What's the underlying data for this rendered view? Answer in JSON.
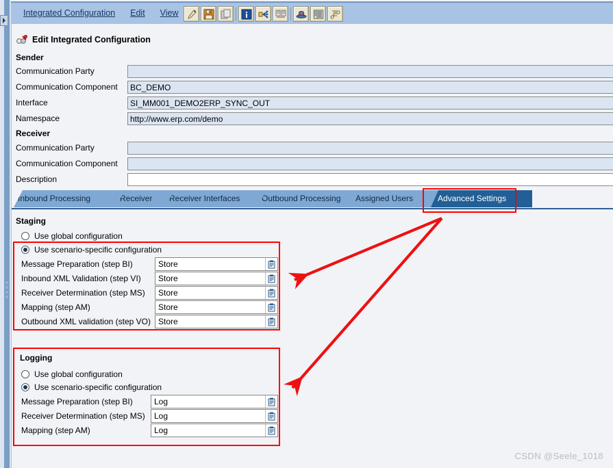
{
  "window": {
    "menu": [
      "Integrated Configuration",
      "Edit",
      "View"
    ],
    "toolbar_icons": [
      "edit-pencil-icon",
      "save-disk-icon",
      "copy-icon",
      "information-icon",
      "expand-arrows-icon",
      "compare-icon",
      "hat-icon",
      "table-icon",
      "scroll-icon"
    ]
  },
  "page": {
    "title": "Edit Integrated Configuration",
    "title_icon": "objects-icon"
  },
  "sender": {
    "heading": "Sender",
    "fields": [
      {
        "label": "Communication Party",
        "value": "",
        "readonly": true
      },
      {
        "label": "Communication Component",
        "value": "BC_DEMO",
        "readonly": true
      },
      {
        "label": "Interface",
        "value": "SI_MM001_DEMO2ERP_SYNC_OUT",
        "readonly": true
      },
      {
        "label": "Namespace",
        "value": "http://www.erp.com/demo",
        "readonly": true
      }
    ]
  },
  "receiver": {
    "heading": "Receiver",
    "fields": [
      {
        "label": "Communication Party",
        "value": "",
        "readonly": true
      },
      {
        "label": "Communication Component",
        "value": "",
        "readonly": true
      },
      {
        "label": "Description",
        "value": "",
        "readonly": false
      }
    ]
  },
  "tabs": [
    {
      "label": "Inbound Processing",
      "active": false
    },
    {
      "label": "Receiver",
      "active": false
    },
    {
      "label": "Receiver Interfaces",
      "active": false
    },
    {
      "label": "Outbound Processing",
      "active": false
    },
    {
      "label": "Assigned Users",
      "active": false
    },
    {
      "label": "Advanced Settings",
      "active": true
    }
  ],
  "staging": {
    "title": "Staging",
    "option_global": "Use global configuration",
    "option_scenario": "Use scenario-specific configuration",
    "selected": "scenario",
    "rows": [
      {
        "label": "Message Preparation (step BI)",
        "value": "Store"
      },
      {
        "label": "Inbound XML Validation (step VI)",
        "value": "Store"
      },
      {
        "label": "Receiver Determination (step MS)",
        "value": "Store"
      },
      {
        "label": "Mapping (step AM)",
        "value": "Store"
      },
      {
        "label": "Outbound XML validation (step VO)",
        "value": "Store"
      }
    ]
  },
  "logging": {
    "title": "Logging",
    "option_global": "Use global configuration",
    "option_scenario": "Use scenario-specific configuration",
    "selected": "scenario",
    "rows": [
      {
        "label": "Message Preparation (step BI)",
        "value": "Log"
      },
      {
        "label": "Receiver Determination (step MS)",
        "value": "Log"
      },
      {
        "label": "Mapping (step AM)",
        "value": "Log"
      }
    ]
  },
  "annotations": {
    "highlight_color": "#ff0000",
    "watermark": "CSDN @Seele_1018"
  }
}
